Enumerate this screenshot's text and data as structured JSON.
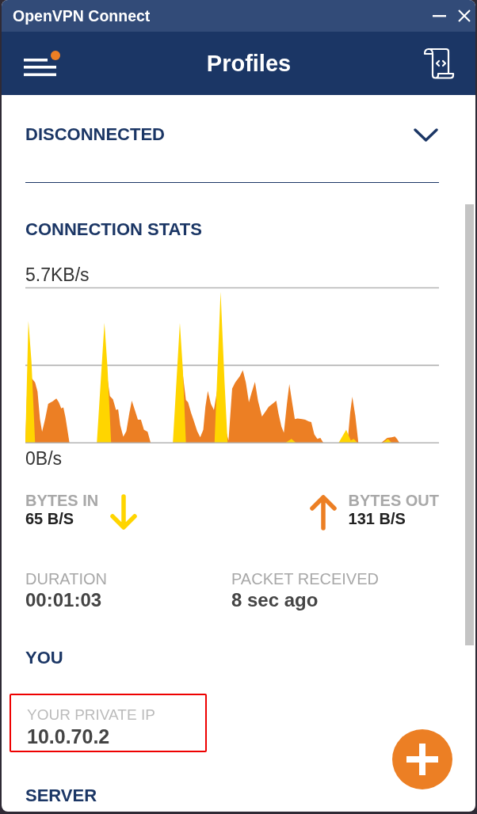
{
  "window": {
    "title": "OpenVPN Connect"
  },
  "header": {
    "title": "Profiles",
    "menu_notification": true
  },
  "connection": {
    "status": "DISCONNECTED"
  },
  "stats": {
    "title": "CONNECTION STATS",
    "graph": {
      "max_label": "5.7KB/s",
      "min_label": "0B/s"
    },
    "rates": [
      {
        "kind": "in",
        "label": "BYTES IN",
        "value": "65 B/S",
        "color": "#ffd500"
      },
      {
        "kind": "out",
        "label": "BYTES OUT",
        "value": "131 B/S",
        "color": "#ec7f24"
      }
    ],
    "details": [
      {
        "label": "DURATION",
        "value": "00:01:03"
      },
      {
        "label": "PACKET RECEIVED",
        "value": "8 sec ago"
      }
    ]
  },
  "you": {
    "title": "YOU",
    "fields": [
      {
        "label": "YOUR PRIVATE IP",
        "value": "10.0.70.2",
        "highlighted": true
      }
    ]
  },
  "server": {
    "title": "SERVER"
  }
}
